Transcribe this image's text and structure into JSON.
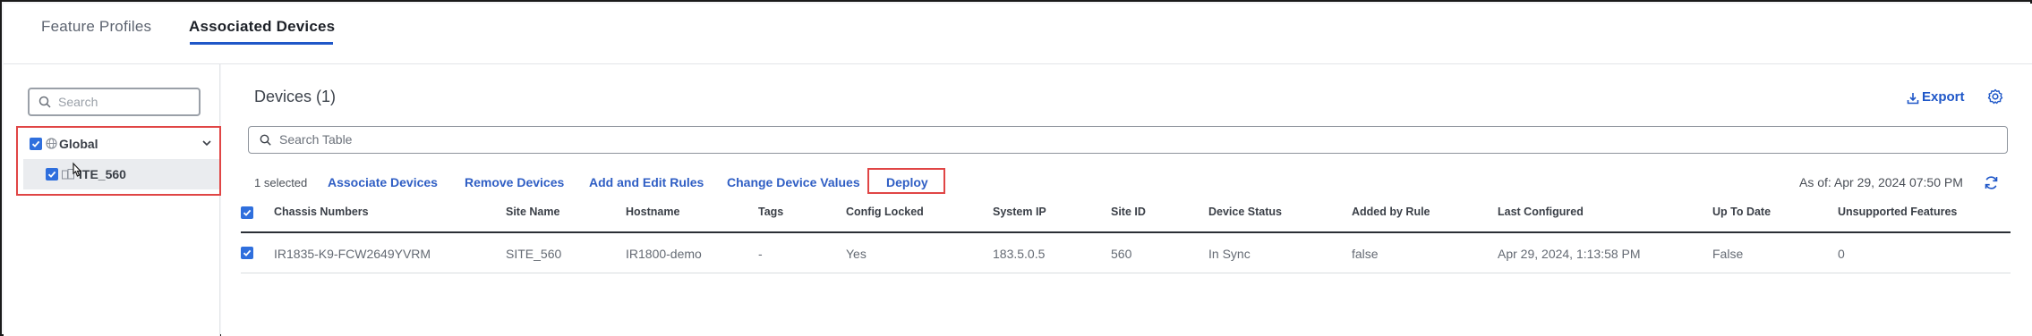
{
  "tabs": [
    {
      "label": "Feature Profiles",
      "active": false
    },
    {
      "label": "Associated Devices",
      "active": true
    }
  ],
  "sidebar": {
    "search_placeholder": "Search",
    "tree": {
      "root": {
        "label": "Global",
        "checked": true,
        "expanded": true,
        "icon": "globe-icon"
      },
      "child": {
        "label": "SITE_560",
        "label_visible": "ITE_560",
        "checked": true,
        "icon": "site-icon"
      }
    }
  },
  "main": {
    "title": "Devices (1)",
    "export_label": "Export",
    "table_search_placeholder": "Search Table",
    "selected_count": "1 selected",
    "actions": [
      "Associate Devices",
      "Remove Devices",
      "Add and Edit Rules",
      "Change Device Values",
      "Deploy"
    ],
    "as_of": "As of: Apr 29, 2024 07:50 PM",
    "columns": [
      "Chassis Numbers",
      "Site Name",
      "Hostname",
      "Tags",
      "Config Locked",
      "System IP",
      "Site ID",
      "Device Status",
      "Added by Rule",
      "Last Configured",
      "Up To Date",
      "Unsupported Features"
    ],
    "rows": [
      [
        "IR1835-K9-FCW2649YVRM",
        "SITE_560",
        "IR1800-demo",
        "-",
        "Yes",
        "183.5.0.5",
        "560",
        "In Sync",
        "false",
        "Apr 29, 2024, 1:13:58 PM",
        "False",
        "0"
      ]
    ]
  },
  "colors": {
    "accent": "#1f57c8",
    "link": "#2f5ec4",
    "checkbox": "#2f6fdd",
    "highlight_box": "#e04545"
  }
}
